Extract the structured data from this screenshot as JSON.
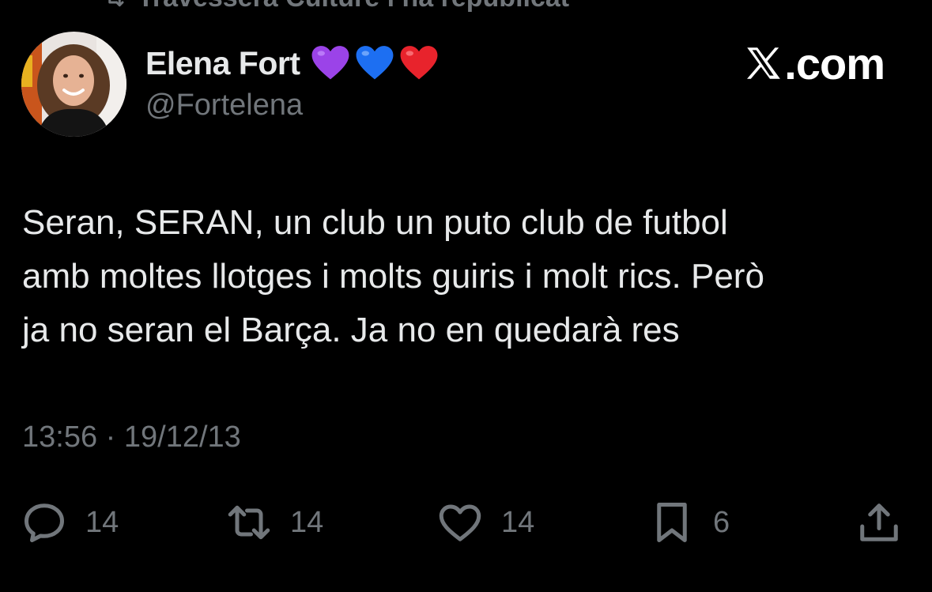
{
  "repost_banner": {
    "text": "Travessera Culture i na republicat"
  },
  "author": {
    "display_name": "Elena Fort",
    "handle": "@Fortelena",
    "name_emojis": [
      "purple-heart-emoji",
      "blue-heart-emoji",
      "red-heart-emoji"
    ],
    "emoji_colors": {
      "purple": "#9b43e8",
      "blue": "#1d6ff2",
      "red": "#e8232c"
    }
  },
  "brand": {
    "label": ".com"
  },
  "tweet": {
    "lines": [
      "Seran, SERAN, un club un puto club de futbol",
      "amb moltes llotges i molts guiris i molt rics. Però",
      "ja no seran el Barça. Ja no en quedarà res"
    ],
    "timestamp": "13:56 · 19/12/13"
  },
  "actions": {
    "reply": {
      "icon": "reply-icon",
      "count": "14"
    },
    "repost": {
      "icon": "repost-icon",
      "count": "14"
    },
    "like": {
      "icon": "like-icon",
      "count": "14"
    },
    "bookmark": {
      "icon": "bookmark-icon",
      "count": "6"
    },
    "share": {
      "icon": "share-icon"
    }
  },
  "colors": {
    "background": "#000000",
    "primary_text": "#e7e9ea",
    "secondary_text": "#71767b"
  }
}
